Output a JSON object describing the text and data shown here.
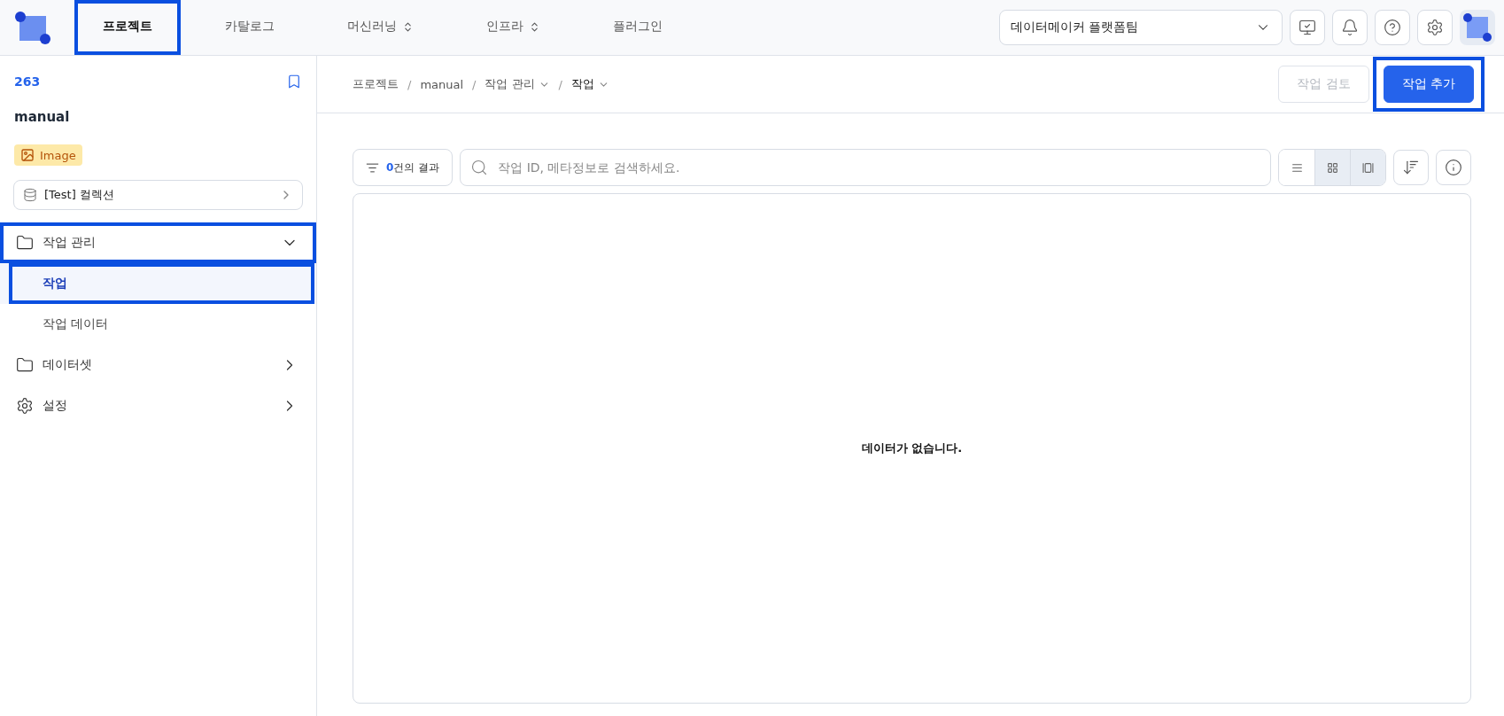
{
  "header": {
    "nav": [
      {
        "label": "프로젝트",
        "selected": true,
        "highlighted": true,
        "dropdown": false
      },
      {
        "label": "카탈로그",
        "selected": false,
        "highlighted": false,
        "dropdown": false
      },
      {
        "label": "머신러닝",
        "selected": false,
        "highlighted": false,
        "dropdown": true
      },
      {
        "label": "인프라",
        "selected": false,
        "highlighted": false,
        "dropdown": true
      },
      {
        "label": "플러그인",
        "selected": false,
        "highlighted": false,
        "dropdown": false
      }
    ],
    "workspace": "데이터메이커 플랫폼팀"
  },
  "sidebar": {
    "project_id": "263",
    "project_name": "manual",
    "type_badge": "Image",
    "collection": "[Test] 컬렉션",
    "items": [
      {
        "label": "작업 관리",
        "kind": "folder",
        "expanded": true,
        "highlighted": true,
        "children": [
          {
            "label": "작업",
            "selected": true,
            "highlighted": true
          },
          {
            "label": "작업 데이터",
            "selected": false,
            "highlighted": false
          }
        ]
      },
      {
        "label": "데이터셋",
        "kind": "folder",
        "expanded": false,
        "highlighted": false
      },
      {
        "label": "설정",
        "kind": "gear",
        "expanded": false,
        "highlighted": false
      }
    ]
  },
  "breadcrumb": [
    {
      "label": "프로젝트",
      "dropdown": false,
      "current": false
    },
    {
      "label": "manual",
      "separator": "/",
      "dropdown": false,
      "current": false
    },
    {
      "label": "작업 관리",
      "separator": "/",
      "dropdown": true,
      "current": false
    },
    {
      "label": "작업",
      "separator": "/",
      "dropdown": true,
      "current": true
    }
  ],
  "actions": [
    {
      "label": "작업 검토",
      "disabled": true,
      "primary": false,
      "highlighted": false
    },
    {
      "label": "작업 추가",
      "disabled": false,
      "primary": true,
      "highlighted": true
    }
  ],
  "toolbar": {
    "result_count": "0",
    "result_label": "건의 결과",
    "search": {
      "placeholder": "작업 ID, 메타정보로 검색하세요."
    },
    "views": [
      {
        "kind": "list",
        "selected": false
      },
      {
        "kind": "grid",
        "selected": true
      },
      {
        "kind": "card",
        "selected": true
      }
    ]
  },
  "empty_message": "데이터가 없습니다."
}
